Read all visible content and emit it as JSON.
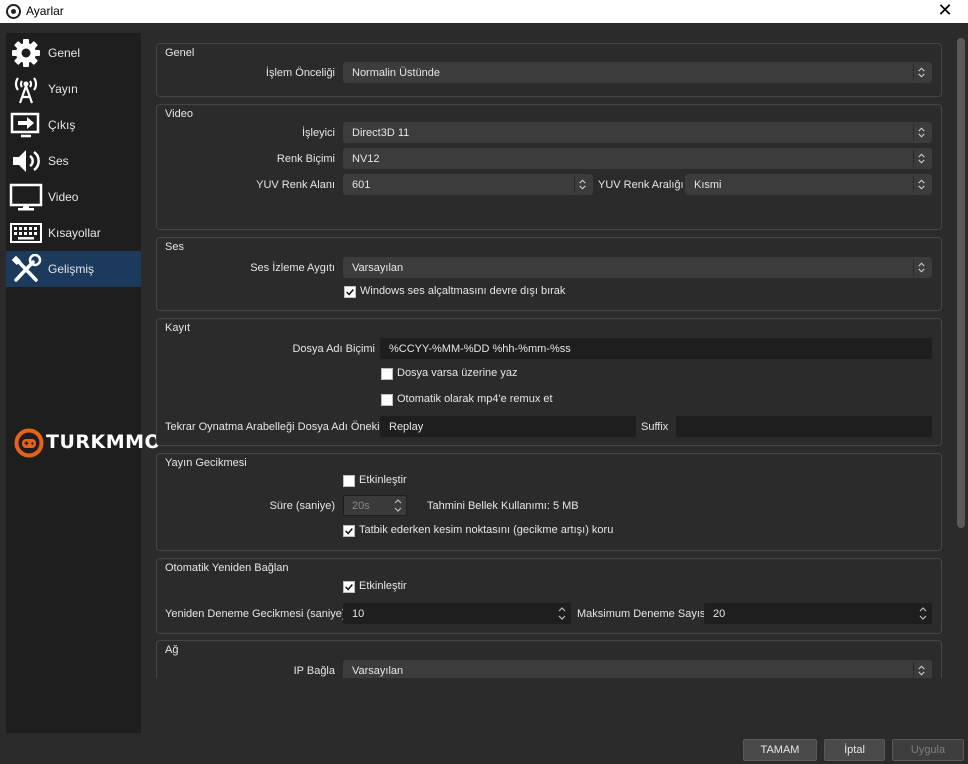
{
  "window": {
    "title": "Ayarlar",
    "close_glyph": "✕"
  },
  "sidebar": {
    "items": [
      {
        "label": "Genel",
        "icon": "gear-icon"
      },
      {
        "label": "Yayın",
        "icon": "broadcast-icon"
      },
      {
        "label": "Çıkış",
        "icon": "output-icon"
      },
      {
        "label": "Ses",
        "icon": "speaker-icon"
      },
      {
        "label": "Video",
        "icon": "monitor-icon"
      },
      {
        "label": "Kısayollar",
        "icon": "keyboard-icon"
      },
      {
        "label": "Gelişmiş",
        "icon": "tools-icon"
      }
    ],
    "active_index": 6
  },
  "watermark": {
    "text": "TURKMMO"
  },
  "general": {
    "title": "Genel",
    "priority_label": "İşlem Önceliği",
    "priority_value": "Normalin Üstünde"
  },
  "video": {
    "title": "Video",
    "renderer_label": "İşleyici",
    "renderer_value": "Direct3D 11",
    "color_format_label": "Renk Biçimi",
    "color_format_value": "NV12",
    "yuv_space_label": "YUV Renk Alanı",
    "yuv_space_value": "601",
    "yuv_range_label": "YUV Renk Aralığı",
    "yuv_range_value": "Kısmi"
  },
  "audio": {
    "title": "Ses",
    "monitor_label": "Ses İzleme Aygıtı",
    "monitor_value": "Varsayılan",
    "ducking_label": "Windows ses alçaltmasını devre dışı bırak",
    "ducking_checked": true
  },
  "recording": {
    "title": "Kayıt",
    "filename_label": "Dosya Adı Biçimi",
    "filename_value": "%CCYY-%MM-%DD %hh-%mm-%ss",
    "overwrite_label": "Dosya varsa üzerine yaz",
    "overwrite_checked": false,
    "remux_label": "Otomatik olarak mp4'e remux et",
    "remux_checked": false,
    "replay_prefix_label": "Tekrar Oynatma Arabelleği Dosya Adı Öneki",
    "replay_prefix_value": "Replay",
    "suffix_label": "Suffix",
    "suffix_value": ""
  },
  "stream_delay": {
    "title": "Yayın Gecikmesi",
    "enable_label": "Etkinleştir",
    "enable_checked": false,
    "duration_label": "Süre (saniye)",
    "duration_value": "20s",
    "memory_text": "Tahmini Bellek Kullanımı: 5 MB",
    "preserve_label": "Tatbik ederken kesim noktasını (gecikme artışı) koru",
    "preserve_checked": true
  },
  "reconnect": {
    "title": "Otomatik Yeniden Bağlan",
    "enable_label": "Etkinleştir",
    "enable_checked": true,
    "retry_delay_label": "Yeniden Deneme Gecikmesi (saniye)",
    "retry_delay_value": "10",
    "max_retries_label": "Maksimum Deneme Sayısı",
    "max_retries_value": "20"
  },
  "network": {
    "title": "Ağ",
    "bind_ip_label": "IP Bağla",
    "bind_ip_value": "Varsayılan"
  },
  "buttons": {
    "ok": "TAMAM",
    "cancel": "İptal",
    "apply": "Uygula"
  },
  "colors": {
    "background": "#2b2b2b",
    "sidebar": "#1e1e1e",
    "active_item": "#1b3a5c",
    "watermark_orange": "#e8631a"
  }
}
